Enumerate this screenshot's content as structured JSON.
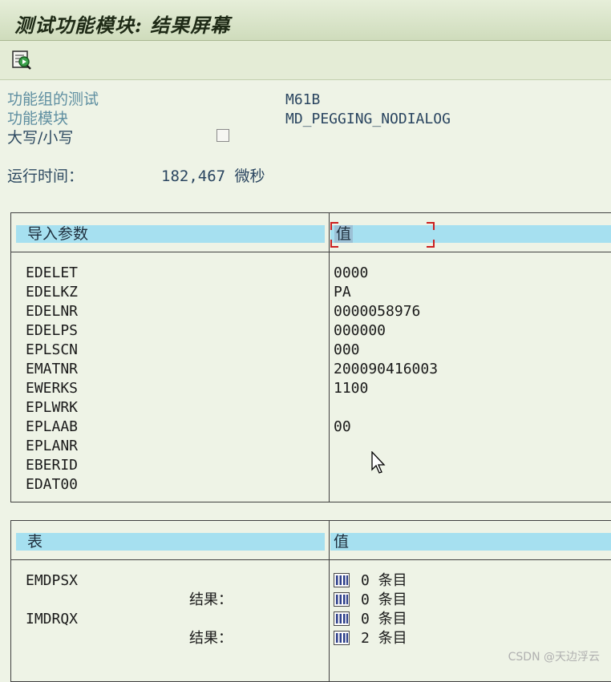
{
  "window": {
    "title": "测试功能模块: 结果屏幕"
  },
  "toolbar": {
    "execute_icon": "execute-icon"
  },
  "header": {
    "function_group_label": "功能组的测试",
    "function_group_value": "M61B",
    "function_module_label": "功能模块",
    "function_module_value": "MD_PEGGING_NODIALOG",
    "case_label": "大写/小写",
    "case_checked": false,
    "runtime_label": "运行时间：",
    "runtime_value": "182,467 微秒"
  },
  "import_params": {
    "header_param": "导入参数",
    "header_value": "值",
    "rows": [
      {
        "name": "EDELET",
        "value": "0000"
      },
      {
        "name": "EDELKZ",
        "value": "PA"
      },
      {
        "name": "EDELNR",
        "value": "0000058976"
      },
      {
        "name": "EDELPS",
        "value": "000000"
      },
      {
        "name": "EPLSCN",
        "value": "000"
      },
      {
        "name": "EMATNR",
        "value": "200090416003"
      },
      {
        "name": "EWERKS",
        "value": "1100"
      },
      {
        "name": "EPLWRK",
        "value": ""
      },
      {
        "name": "EPLAAB",
        "value": "00"
      },
      {
        "name": "EPLANR",
        "value": ""
      },
      {
        "name": "EBERID",
        "value": ""
      },
      {
        "name": "EDAT00",
        "value": ""
      }
    ]
  },
  "tables": {
    "header_param": "表",
    "header_value": "值",
    "rows": [
      {
        "name": "EMDPSX",
        "entries": "0 条目"
      },
      {
        "name": "",
        "result_label": "结果：",
        "entries": "0 条目"
      },
      {
        "name": "IMDRQX",
        "entries": "0 条目"
      },
      {
        "name": "",
        "result_label": "结果：",
        "entries": "2 条目"
      }
    ]
  },
  "watermark": "CSDN @天边浮云"
}
